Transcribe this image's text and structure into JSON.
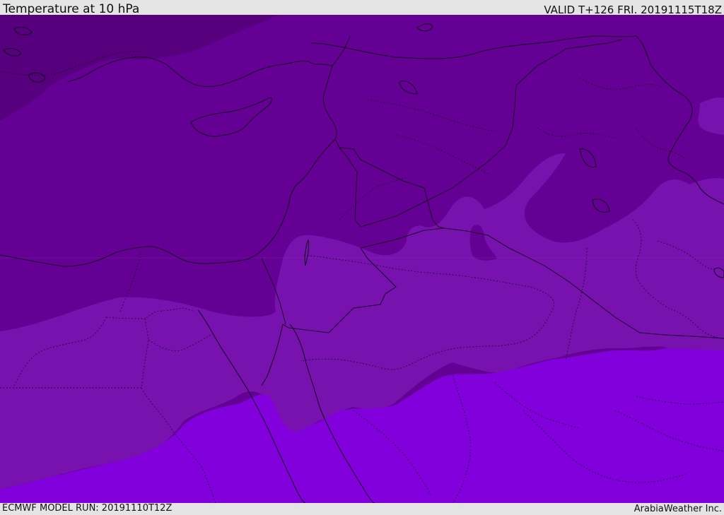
{
  "header": {
    "title": "Temperature at 10 hPa",
    "valid_time": "VALID T+126 FRI. 20191115T18Z"
  },
  "footer": {
    "model_run": "ECMWF MODEL RUN: 20191110T12Z",
    "credit": "ArabiaWeather Inc."
  },
  "map": {
    "fill_colors": {
      "coldest": "#56007e",
      "cold": "#650094",
      "mid": "#7812ae",
      "warm": "#8200dc"
    },
    "line_color": "#1a0026"
  }
}
